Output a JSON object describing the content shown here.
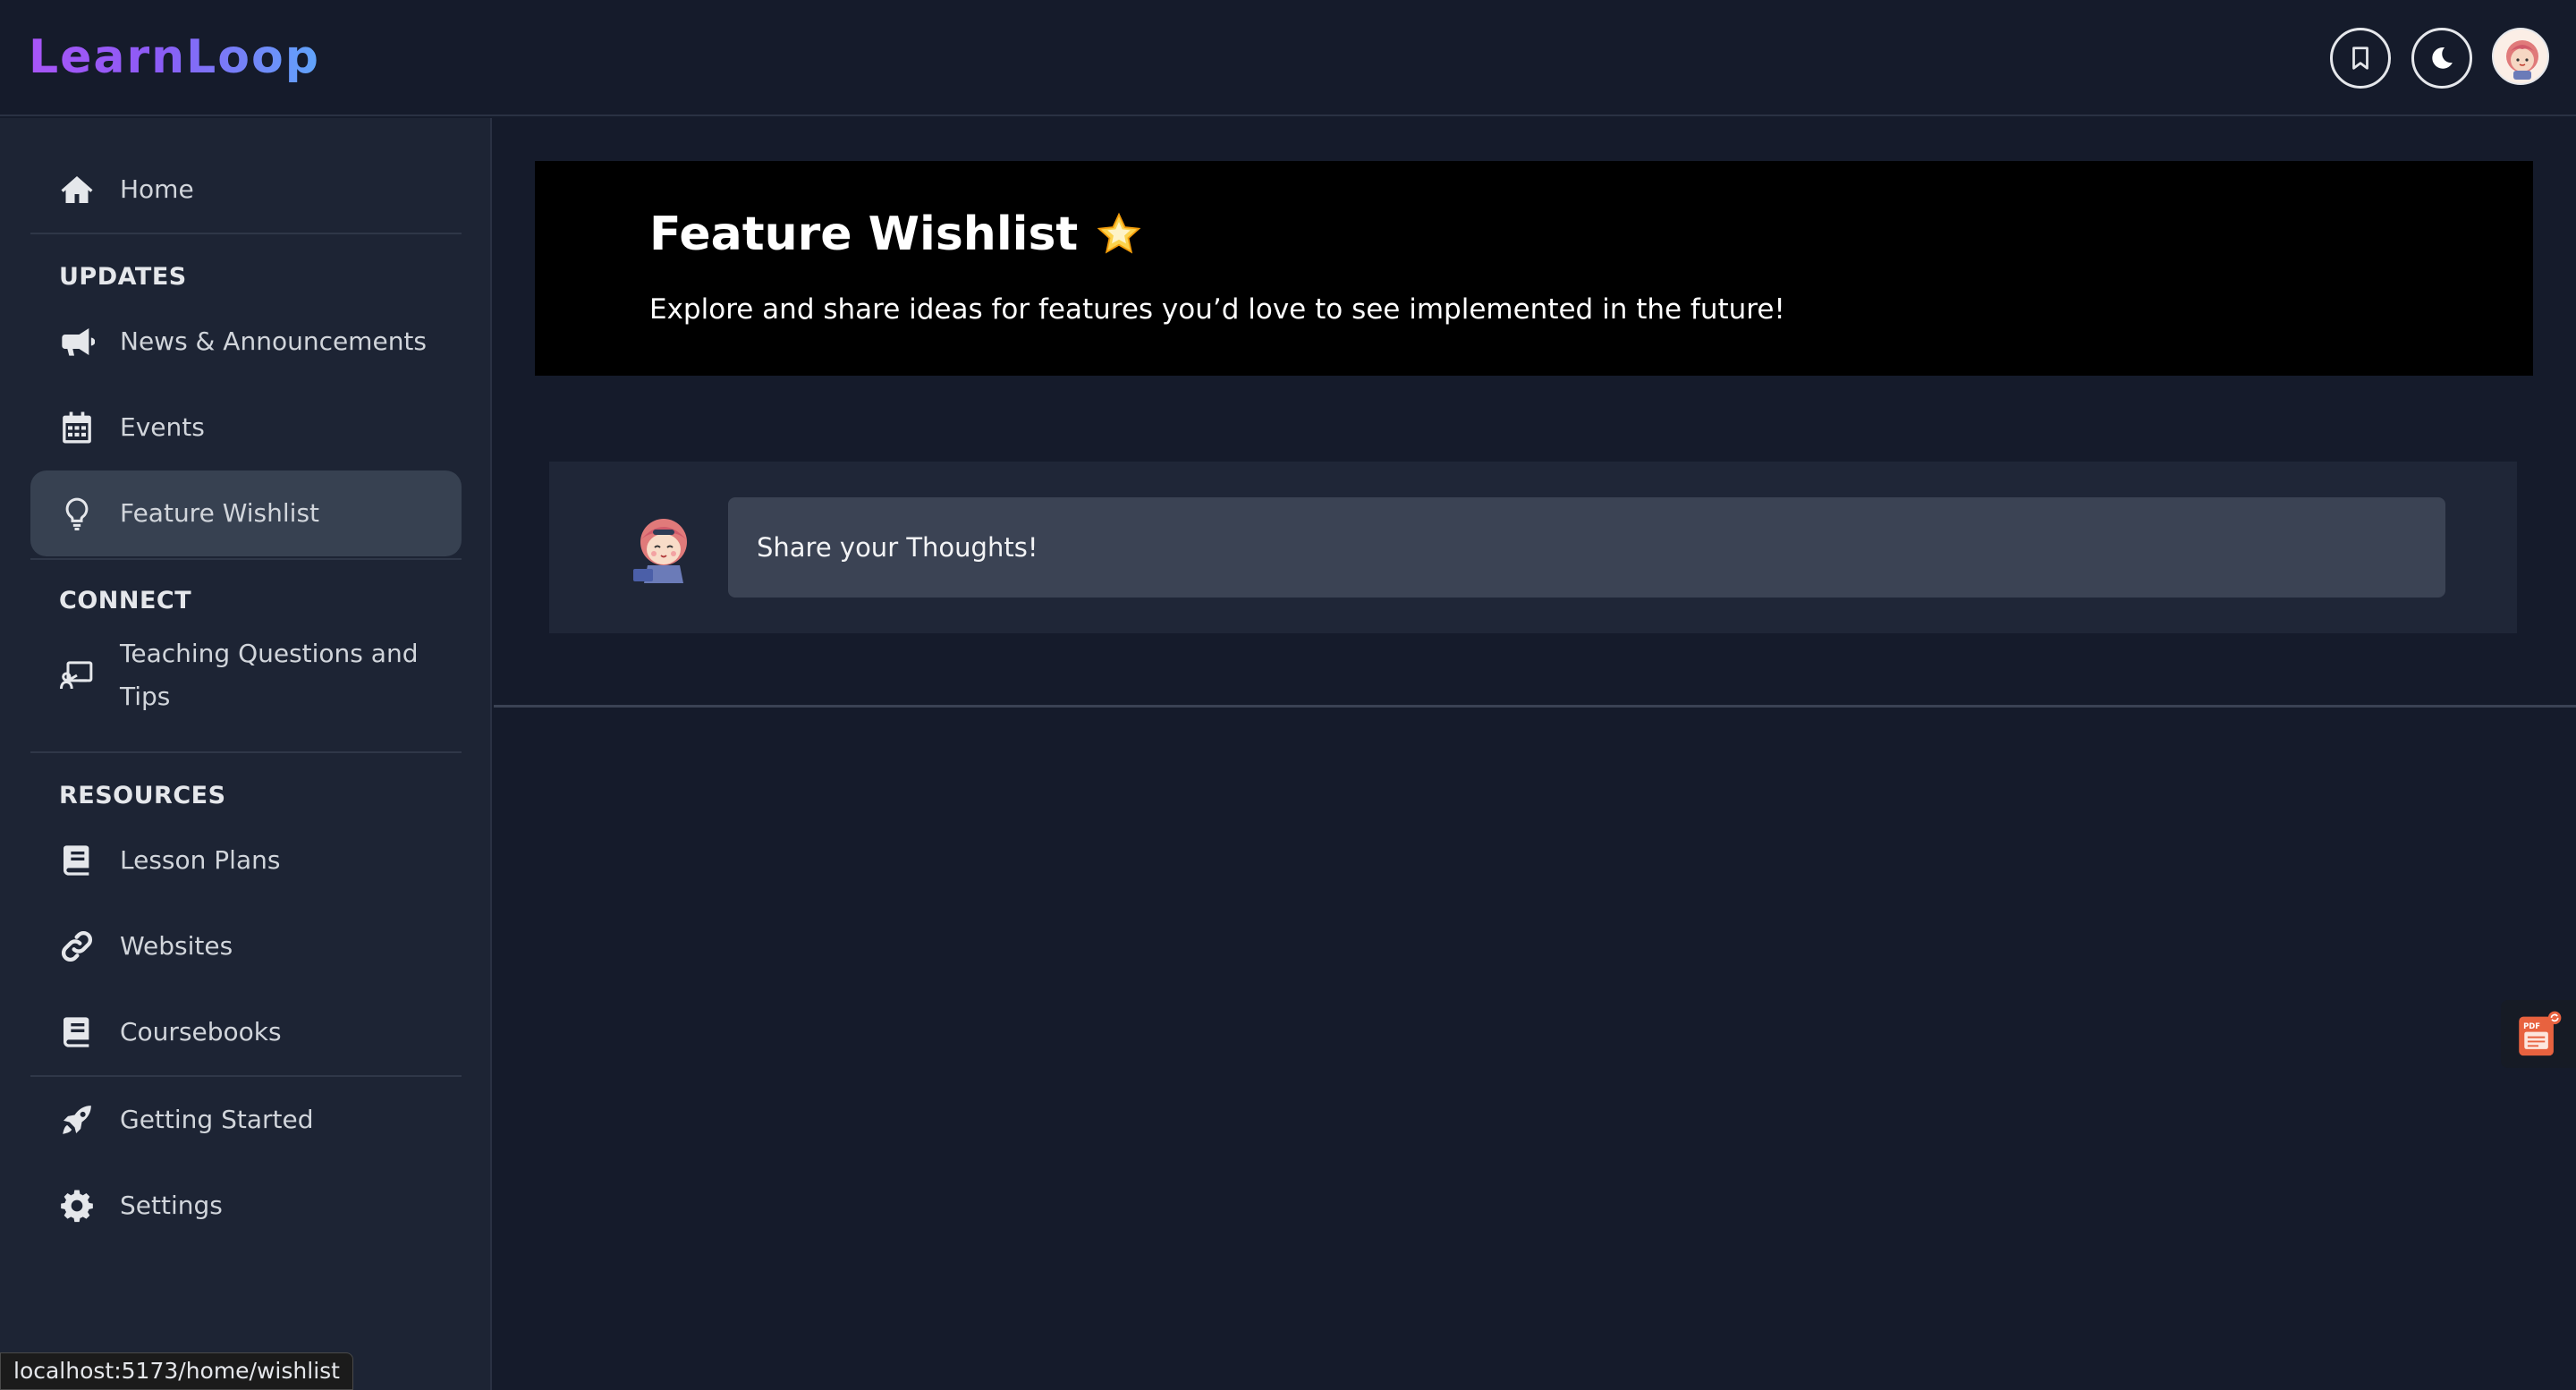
{
  "app": {
    "logo_text": "LearnLoop"
  },
  "topbar": {
    "bookmark_icon": "bookmark-icon",
    "theme_icon": "moon-icon",
    "avatar_icon": "avatar-icon"
  },
  "sidebar": {
    "items": [
      {
        "label": "Home",
        "icon": "home-icon"
      },
      {
        "label": "News & Announcements",
        "icon": "megaphone-icon"
      },
      {
        "label": "Events",
        "icon": "calendar-icon"
      },
      {
        "label": "Feature Wishlist",
        "icon": "lightbulb-icon",
        "active": true
      },
      {
        "label": "Teaching Questions and Tips",
        "icon": "chalkboard-icon"
      },
      {
        "label": "Lesson Plans",
        "icon": "book-icon"
      },
      {
        "label": "Websites",
        "icon": "link-icon"
      },
      {
        "label": "Coursebooks",
        "icon": "book-icon"
      },
      {
        "label": "Getting Started",
        "icon": "rocket-icon"
      },
      {
        "label": "Settings",
        "icon": "gear-icon"
      }
    ],
    "sections": {
      "updates": "UPDATES",
      "connect": "CONNECT",
      "resources": "RESOURCES"
    },
    "teaching_line1": "Teaching Questions and",
    "teaching_line2": "Tips"
  },
  "main": {
    "title": "Feature Wishlist",
    "subtitle": "Explore and share ideas for features you’d love to see implemented in the future!",
    "compose_placeholder": "Share your Thoughts!"
  },
  "status_bar": {
    "url": "localhost:5173/home/wishlist"
  },
  "colors": {
    "background": "#151b2b",
    "sidebar": "#1d2434",
    "active_item": "#374151",
    "hero": "#000000",
    "accent_start": "#a855f7",
    "accent_end": "#60a5fa"
  }
}
